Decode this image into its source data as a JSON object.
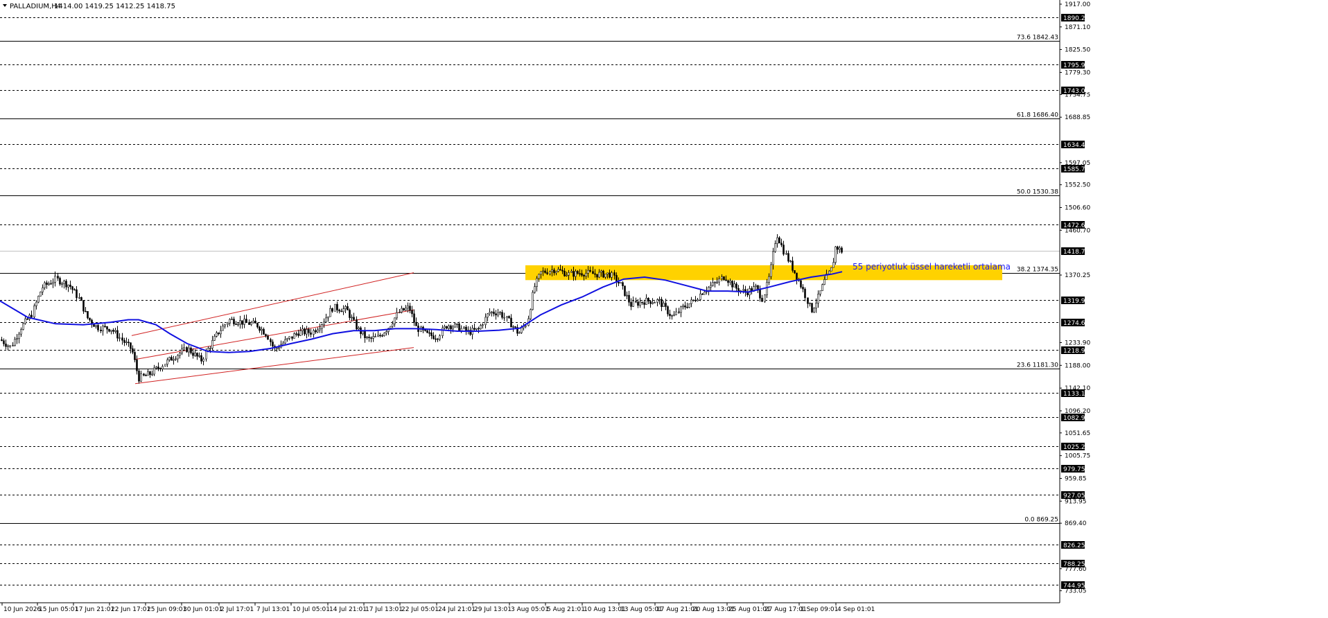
{
  "header": {
    "symbol": "PALLADIUM,H4",
    "ohlc": "1414.00 1419.25 1412.25 1418.75"
  },
  "chart_data": {
    "type": "candlestick",
    "symbol": "PALLADIUM",
    "timeframe": "H4",
    "ylim": [
      727,
      1922
    ],
    "grid": false,
    "current_price": 1418.75,
    "y_tick_labels": [
      "1917.00",
      "1871.10",
      "1825.50",
      "1779.30",
      "1734.75",
      "1688.85",
      "1597.05",
      "1552.50",
      "1506.60",
      "1460.70",
      "1370.25",
      "1233.90",
      "1188.00",
      "1142.10",
      "1096.20",
      "1051.65",
      "1005.75",
      "959.85",
      "913.95",
      "869.40",
      "777.60",
      "733.05"
    ],
    "x_tick_labels": [
      "10 Jun 2026",
      "15 Jun 05:01",
      "17 Jun 21:01",
      "22 Jun 17:01",
      "25 Jun 09:01",
      "30 Jun 01:01",
      "2 Jul 17:01",
      "7 Jul 13:01",
      "10 Jul 05:01",
      "14 Jul 21:01",
      "17 Jul 13:01",
      "22 Jul 05:01",
      "24 Jul 21:01",
      "29 Jul 13:01",
      "3 Aug 05:01",
      "5 Aug 21:01",
      "10 Aug 13:01",
      "13 Aug 05:01",
      "17 Aug 21:01",
      "20 Aug 13:01",
      "25 Aug 01:01",
      "27 Aug 17:01",
      "1 Sep 09:01",
      "4 Sep 01:01"
    ],
    "horizontal_levels": [
      {
        "price": 1890.25,
        "label": "1890.25",
        "style": "dashed"
      },
      {
        "price": 1795.95,
        "label": "1795.95",
        "style": "dashed"
      },
      {
        "price": 1743.0,
        "label": "1743.00",
        "style": "dashed"
      },
      {
        "price": 1634.45,
        "label": "1634.45",
        "style": "dashed"
      },
      {
        "price": 1585.75,
        "label": "1585.75",
        "style": "dashed"
      },
      {
        "price": 1472.6,
        "label": "1472.60",
        "style": "dashed"
      },
      {
        "price": 1418.75,
        "label": "1418.75",
        "style": "current"
      },
      {
        "price": 1319.95,
        "label": "1319.95",
        "style": "dashed"
      },
      {
        "price": 1274.6,
        "label": "1274.60",
        "style": "dashed"
      },
      {
        "price": 1218.95,
        "label": "1218.95",
        "style": "dashed"
      },
      {
        "price": 1133.1,
        "label": "1133.10",
        "style": "dashed"
      },
      {
        "price": 1082.9,
        "label": "1082.90",
        "style": "dashed"
      },
      {
        "price": 1025.25,
        "label": "1025.25",
        "style": "dashed"
      },
      {
        "price": 979.75,
        "label": "979.75",
        "style": "dashed"
      },
      {
        "price": 927.05,
        "label": "927.05",
        "style": "dashed"
      },
      {
        "price": 826.25,
        "label": "826.25",
        "style": "dashed"
      },
      {
        "price": 788.25,
        "label": "788.25",
        "style": "dashed"
      },
      {
        "price": 744.95,
        "label": "744.95",
        "style": "dashed"
      }
    ],
    "fibonacci_levels": [
      {
        "price": 1842.43,
        "label": "73.6 1842.43"
      },
      {
        "price": 1686.4,
        "label": "61.8 1686.40"
      },
      {
        "price": 1530.38,
        "label": "50.0 1530.38"
      },
      {
        "price": 1374.35,
        "label": "38.2 1374.35"
      },
      {
        "price": 1181.3,
        "label": "23.6 1181.30"
      },
      {
        "price": 869.25,
        "label": "0.0 869.25"
      }
    ],
    "resistance_zone": {
      "from": 1360,
      "to": 1390,
      "color": "#ffd200"
    },
    "ema": {
      "label": "55 periyotluk üssel hareketli ortalama",
      "color": "#1010e0",
      "points": [
        [
          0,
          1318
        ],
        [
          40,
          1285
        ],
        [
          80,
          1272
        ],
        [
          120,
          1270
        ],
        [
          160,
          1275
        ],
        [
          185,
          1280
        ],
        [
          200,
          1280
        ],
        [
          225,
          1270
        ],
        [
          245,
          1252
        ],
        [
          270,
          1232
        ],
        [
          300,
          1216
        ],
        [
          330,
          1214
        ],
        [
          360,
          1216
        ],
        [
          390,
          1222
        ],
        [
          420,
          1232
        ],
        [
          450,
          1241
        ],
        [
          480,
          1252
        ],
        [
          510,
          1258
        ],
        [
          540,
          1258
        ],
        [
          570,
          1262
        ],
        [
          600,
          1262
        ],
        [
          630,
          1260
        ],
        [
          660,
          1257
        ],
        [
          690,
          1257
        ],
        [
          720,
          1259
        ],
        [
          750,
          1263
        ],
        [
          780,
          1290
        ],
        [
          810,
          1310
        ],
        [
          840,
          1326
        ],
        [
          870,
          1346
        ],
        [
          900,
          1362
        ],
        [
          930,
          1366
        ],
        [
          960,
          1360
        ],
        [
          990,
          1349
        ],
        [
          1020,
          1338
        ],
        [
          1050,
          1338
        ],
        [
          1080,
          1336
        ],
        [
          1110,
          1346
        ],
        [
          1140,
          1357
        ],
        [
          1170,
          1366
        ],
        [
          1200,
          1372
        ],
        [
          1215,
          1377
        ]
      ]
    },
    "channel": {
      "color": "#d02020",
      "upper": [
        [
          190,
          1248
        ],
        [
          597,
          1375
        ]
      ],
      "middle": [
        [
          195,
          1200
        ],
        [
          597,
          1300
        ]
      ],
      "lower": [
        [
          195,
          1151
        ],
        [
          597,
          1224
        ]
      ]
    },
    "candles_path": [
      [
        0,
        1240
      ],
      [
        15,
        1225
      ],
      [
        30,
        1265
      ],
      [
        45,
        1290
      ],
      [
        60,
        1345
      ],
      [
        80,
        1362
      ],
      [
        100,
        1350
      ],
      [
        115,
        1320
      ],
      [
        125,
        1285
      ],
      [
        140,
        1265
      ],
      [
        160,
        1262
      ],
      [
        175,
        1240
      ],
      [
        190,
        1220
      ],
      [
        200,
        1162
      ],
      [
        215,
        1170
      ],
      [
        230,
        1185
      ],
      [
        250,
        1205
      ],
      [
        270,
        1222
      ],
      [
        290,
        1198
      ],
      [
        300,
        1222
      ],
      [
        315,
        1255
      ],
      [
        330,
        1280
      ],
      [
        350,
        1275
      ],
      [
        370,
        1270
      ],
      [
        385,
        1250
      ],
      [
        395,
        1220
      ],
      [
        410,
        1235
      ],
      [
        430,
        1255
      ],
      [
        450,
        1255
      ],
      [
        465,
        1275
      ],
      [
        480,
        1305
      ],
      [
        500,
        1300
      ],
      [
        515,
        1262
      ],
      [
        530,
        1240
      ],
      [
        545,
        1245
      ],
      [
        560,
        1265
      ],
      [
        575,
        1295
      ],
      [
        590,
        1305
      ],
      [
        600,
        1265
      ],
      [
        615,
        1250
      ],
      [
        630,
        1246
      ],
      [
        645,
        1270
      ],
      [
        660,
        1265
      ],
      [
        675,
        1255
      ],
      [
        690,
        1260
      ],
      [
        705,
        1295
      ],
      [
        720,
        1295
      ],
      [
        735,
        1275
      ],
      [
        748,
        1252
      ],
      [
        760,
        1275
      ],
      [
        770,
        1345
      ],
      [
        780,
        1375
      ],
      [
        800,
        1382
      ],
      [
        820,
        1372
      ],
      [
        840,
        1375
      ],
      [
        860,
        1372
      ],
      [
        880,
        1372
      ],
      [
        895,
        1350
      ],
      [
        910,
        1310
      ],
      [
        930,
        1318
      ],
      [
        950,
        1318
      ],
      [
        970,
        1285
      ],
      [
        985,
        1305
      ],
      [
        1000,
        1318
      ],
      [
        1015,
        1340
      ],
      [
        1030,
        1352
      ],
      [
        1045,
        1368
      ],
      [
        1060,
        1345
      ],
      [
        1075,
        1335
      ],
      [
        1090,
        1345
      ],
      [
        1100,
        1322
      ],
      [
        1110,
        1370
      ],
      [
        1120,
        1455
      ],
      [
        1130,
        1420
      ],
      [
        1140,
        1392
      ],
      [
        1150,
        1365
      ],
      [
        1160,
        1335
      ],
      [
        1170,
        1298
      ],
      [
        1180,
        1325
      ],
      [
        1190,
        1360
      ],
      [
        1200,
        1385
      ],
      [
        1205,
        1428
      ],
      [
        1215,
        1418
      ]
    ]
  },
  "annotation": "55 periyotluk üssel hareketli ortalama"
}
